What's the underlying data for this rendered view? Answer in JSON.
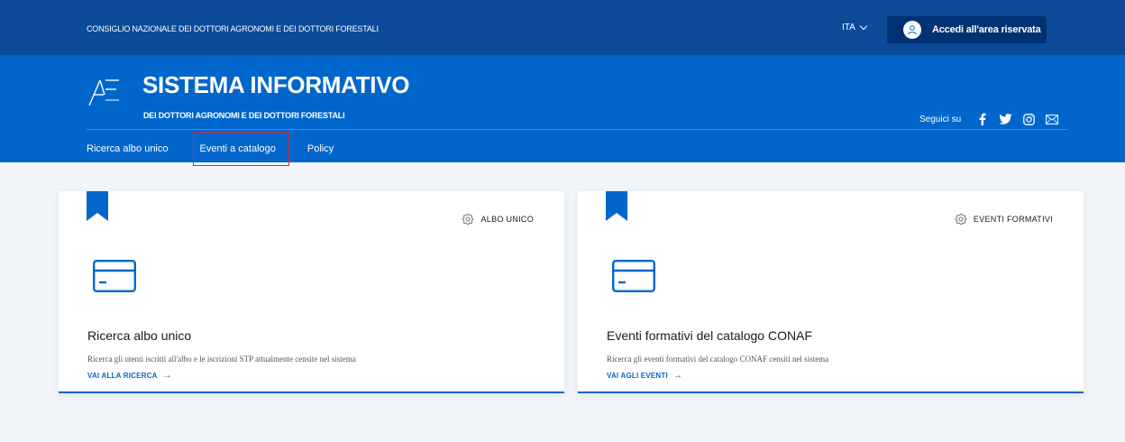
{
  "topbar": {
    "org_name": "CONSIGLIO NAZIONALE DEI DOTTORI AGRONOMI E DEI DOTTORI FORESTALI",
    "language": "ITA",
    "login_label": "Accedi all'area riservata"
  },
  "header": {
    "title": "SISTEMA INFORMATIVO",
    "subtitle": "DEI DOTTORI AGRONOMI E DEI DOTTORI FORESTALI",
    "follow_label": "Seguici su",
    "social_icons": [
      "facebook-icon",
      "twitter-icon",
      "instagram-icon",
      "mail-icon"
    ]
  },
  "nav": {
    "items": [
      {
        "label": "Ricerca albo unico"
      },
      {
        "label": "Eventi a catalogo"
      },
      {
        "label": "Policy"
      }
    ]
  },
  "cards": [
    {
      "category": "ALBO UNICO",
      "title": "Ricerca albo unico",
      "text": "Ricerca gli utenti iscritti all'albo e le iscrizioni STP attualmente censite nel sistema",
      "link": "VAI ALLA RICERCA"
    },
    {
      "category": "EVENTI FORMATIVI",
      "title": "Eventi formativi del catalogo CONAF",
      "text": "Ricerca gli eventi formativi del catalogo CONAF censiti nel sistema",
      "link": "VAI AGLI EVENTI"
    }
  ],
  "colors": {
    "topbar": "#0b4b9a",
    "header": "#0066cc",
    "login_button": "#003173",
    "accent": "#0066cc",
    "highlight": "#d9262c",
    "background": "#f2f6fa"
  }
}
